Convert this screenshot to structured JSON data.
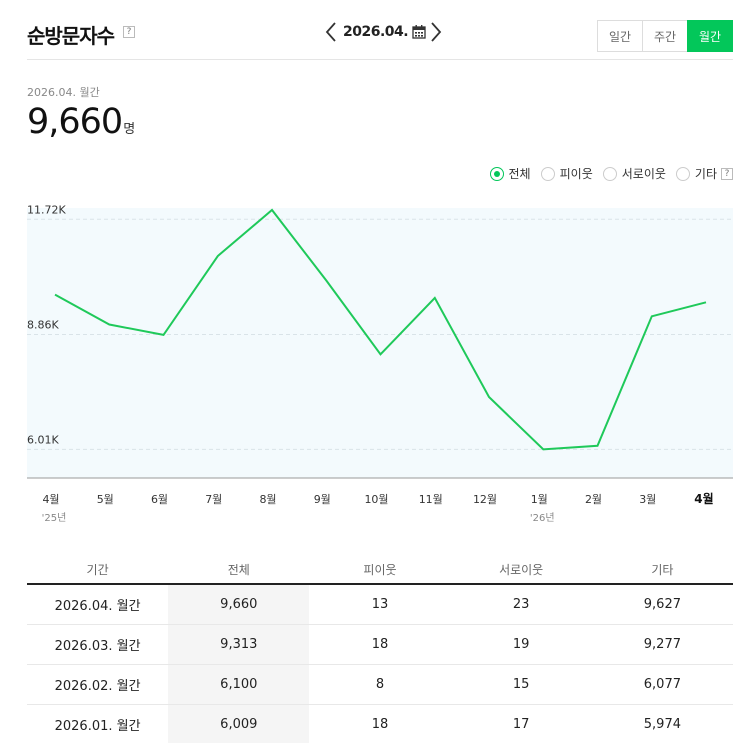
{
  "header": {
    "title": "순방문자수",
    "help_mark": "?",
    "month": "2026.04.",
    "tabs": [
      {
        "label": "일간",
        "active": false
      },
      {
        "label": "주간",
        "active": false
      },
      {
        "label": "월간",
        "active": true
      }
    ]
  },
  "summary": {
    "label": "2026.04. 월간",
    "value": "9,660",
    "unit": "명"
  },
  "legend": {
    "items": [
      {
        "label": "전체",
        "selected": true
      },
      {
        "label": "피이웃",
        "selected": false
      },
      {
        "label": "서로이웃",
        "selected": false
      },
      {
        "label": "기타",
        "selected": false
      }
    ],
    "help_mark": "?"
  },
  "chart_data": {
    "type": "line",
    "categories": [
      "4월",
      "5월",
      "6월",
      "7월",
      "8월",
      "9월",
      "10월",
      "11월",
      "12월",
      "1월",
      "2월",
      "3월",
      "4월"
    ],
    "year_labels": [
      {
        "index": 0,
        "text": "'25년"
      },
      {
        "index": 9,
        "text": "'26년"
      }
    ],
    "series": [
      {
        "values": [
          9850,
          9110,
          8850,
          10810,
          11950,
          10200,
          8370,
          9770,
          7310,
          6009,
          6100,
          9313,
          9660
        ]
      }
    ],
    "yticks": [
      {
        "value": 11720,
        "label": "11.72K"
      },
      {
        "value": 8860,
        "label": "8.86K"
      },
      {
        "value": 6010,
        "label": "6.01K"
      }
    ],
    "ylim": [
      5300,
      12000
    ],
    "highlight_index": 12,
    "color": "#1fc95a",
    "background": "#f3fafd"
  },
  "table": {
    "headers": [
      "기간",
      "전체",
      "피이웃",
      "서로이웃",
      "기타"
    ],
    "rows": [
      [
        "2026.04. 월간",
        "9,660",
        "13",
        "23",
        "9,627"
      ],
      [
        "2026.03. 월간",
        "9,313",
        "18",
        "19",
        "9,277"
      ],
      [
        "2026.02. 월간",
        "6,100",
        "8",
        "15",
        "6,077"
      ],
      [
        "2026.01. 월간",
        "6,009",
        "18",
        "17",
        "5,974"
      ]
    ]
  },
  "colors": {
    "accent": "#03c75a",
    "line": "#1fc95a"
  }
}
